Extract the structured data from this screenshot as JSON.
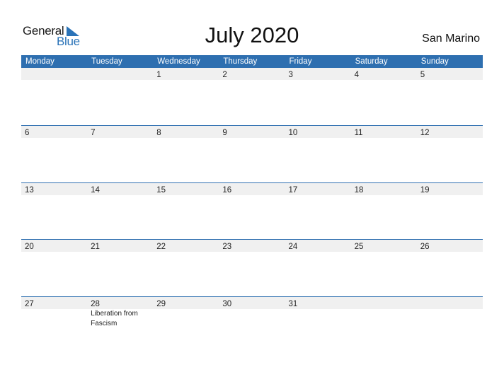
{
  "logo": {
    "word1": "General",
    "word2": "Blue",
    "accent": "#2a73b8"
  },
  "title": "July 2020",
  "country": "San Marino",
  "colors": {
    "header_bg": "#2e6fb0",
    "date_band": "#f0f0f0"
  },
  "weekdays": [
    "Monday",
    "Tuesday",
    "Wednesday",
    "Thursday",
    "Friday",
    "Saturday",
    "Sunday"
  ],
  "weeks": [
    {
      "days": [
        "",
        "",
        "1",
        "2",
        "3",
        "4",
        "5"
      ],
      "events": [
        "",
        "",
        "",
        "",
        "",
        "",
        ""
      ]
    },
    {
      "days": [
        "6",
        "7",
        "8",
        "9",
        "10",
        "11",
        "12"
      ],
      "events": [
        "",
        "",
        "",
        "",
        "",
        "",
        ""
      ]
    },
    {
      "days": [
        "13",
        "14",
        "15",
        "16",
        "17",
        "18",
        "19"
      ],
      "events": [
        "",
        "",
        "",
        "",
        "",
        "",
        ""
      ]
    },
    {
      "days": [
        "20",
        "21",
        "22",
        "23",
        "24",
        "25",
        "26"
      ],
      "events": [
        "",
        "",
        "",
        "",
        "",
        "",
        ""
      ]
    },
    {
      "days": [
        "27",
        "28",
        "29",
        "30",
        "31",
        "",
        ""
      ],
      "events": [
        "",
        "Liberation from Fascism",
        "",
        "",
        "",
        "",
        ""
      ]
    }
  ]
}
